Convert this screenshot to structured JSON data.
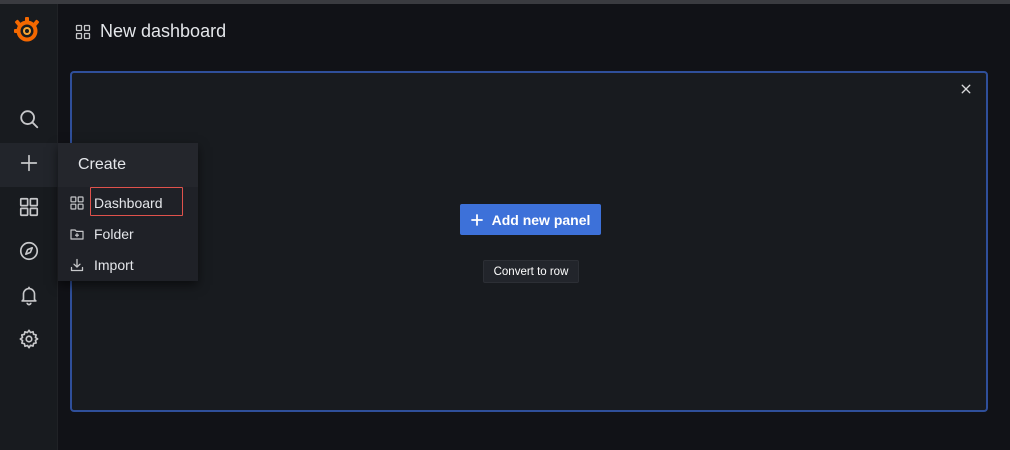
{
  "header": {
    "title": "New dashboard",
    "icon": "dashboard-grid-icon"
  },
  "sidebar": {
    "logo": "grafana-logo",
    "items": [
      {
        "name": "search",
        "icon": "search-icon"
      },
      {
        "name": "create",
        "icon": "plus-icon",
        "active": true
      },
      {
        "name": "dashboards",
        "icon": "grid-icon"
      },
      {
        "name": "explore",
        "icon": "compass-icon"
      },
      {
        "name": "alerting",
        "icon": "bell-icon"
      },
      {
        "name": "configuration",
        "icon": "gear-icon"
      }
    ]
  },
  "create_menu": {
    "title": "Create",
    "items": [
      {
        "label": "Dashboard",
        "icon": "dashboard-grid-icon",
        "highlighted": true
      },
      {
        "label": "Folder",
        "icon": "folder-plus-icon"
      },
      {
        "label": "Import",
        "icon": "import-icon"
      }
    ]
  },
  "panel": {
    "add_panel_label": "Add new panel",
    "convert_label": "Convert to row"
  },
  "colors": {
    "primary": "#3d71d9",
    "panel_border": "#2f4f9a",
    "highlight": "#e0524c",
    "sidebar_bg": "#181b1f",
    "page_bg": "#111217"
  }
}
